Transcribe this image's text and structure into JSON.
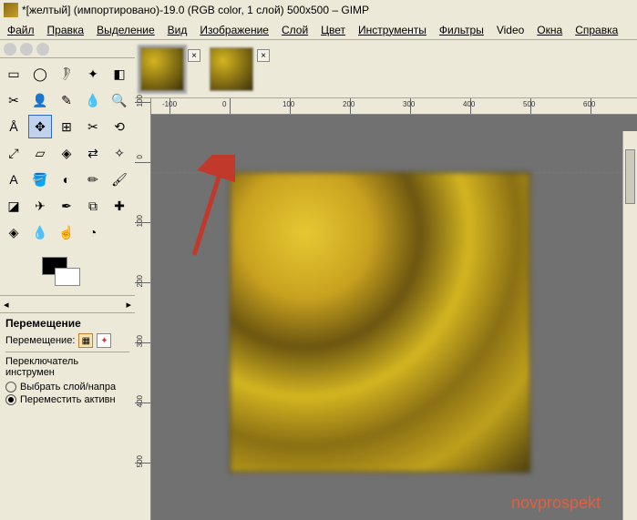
{
  "titlebar": {
    "text": "*[желтый] (импортировано)-19.0 (RGB color, 1 слой) 500x500 – GIMP"
  },
  "menu": {
    "file": "Файл",
    "edit": "Правка",
    "select": "Выделение",
    "view": "Вид",
    "image": "Изображение",
    "layer": "Слой",
    "color": "Цвет",
    "tools": "Инструменты",
    "filters": "Фильтры",
    "video": "Video",
    "windows": "Окна",
    "help": "Справка"
  },
  "hruler_ticks": [
    "-100",
    "0",
    "100",
    "200",
    "300",
    "400",
    "500",
    "600"
  ],
  "vruler_ticks": [
    "100",
    "0",
    "100",
    "200",
    "300",
    "400",
    "500"
  ],
  "move_options": {
    "title": "Перемещение",
    "label_move": "Перемещение:",
    "label_switch": "Переключатель инструмен",
    "radio_pick": "Выбрать слой/напра",
    "radio_move": "Переместить активн"
  },
  "watermark": "novprospekt",
  "tools": [
    {
      "name": "rect-select-icon",
      "glyph": "▭"
    },
    {
      "name": "ellipse-select-icon",
      "glyph": "◯"
    },
    {
      "name": "free-select-icon",
      "glyph": "𓏢"
    },
    {
      "name": "fuzzy-select-icon",
      "glyph": "✦"
    },
    {
      "name": "by-color-select-icon",
      "glyph": "◧"
    },
    {
      "name": "scissors-icon",
      "glyph": "✂"
    },
    {
      "name": "foreground-select-icon",
      "glyph": "👤"
    },
    {
      "name": "paths-icon",
      "glyph": "✎"
    },
    {
      "name": "color-picker-icon",
      "glyph": "💧"
    },
    {
      "name": "zoom-icon",
      "glyph": "🔍"
    },
    {
      "name": "measure-icon",
      "glyph": "Å"
    },
    {
      "name": "move-icon",
      "glyph": "✥",
      "active": true
    },
    {
      "name": "align-icon",
      "glyph": "⊞"
    },
    {
      "name": "crop-icon",
      "glyph": "✂"
    },
    {
      "name": "rotate-icon",
      "glyph": "⟲"
    },
    {
      "name": "scale-icon",
      "glyph": "⤢"
    },
    {
      "name": "shear-icon",
      "glyph": "▱"
    },
    {
      "name": "perspective-icon",
      "glyph": "◈"
    },
    {
      "name": "flip-icon",
      "glyph": "⇄"
    },
    {
      "name": "cage-icon",
      "glyph": "✧"
    },
    {
      "name": "text-icon",
      "glyph": "A"
    },
    {
      "name": "bucket-fill-icon",
      "glyph": "🪣"
    },
    {
      "name": "blend-icon",
      "glyph": "◐"
    },
    {
      "name": "pencil-icon",
      "glyph": "✏"
    },
    {
      "name": "paintbrush-icon",
      "glyph": "🖌"
    },
    {
      "name": "eraser-icon",
      "glyph": "◪"
    },
    {
      "name": "airbrush-icon",
      "glyph": "✈"
    },
    {
      "name": "ink-icon",
      "glyph": "✒"
    },
    {
      "name": "clone-icon",
      "glyph": "⧉"
    },
    {
      "name": "heal-icon",
      "glyph": "✚"
    },
    {
      "name": "perspective-clone-icon",
      "glyph": "◈"
    },
    {
      "name": "blur-icon",
      "glyph": "💧"
    },
    {
      "name": "smudge-icon",
      "glyph": "☝"
    },
    {
      "name": "dodge-burn-icon",
      "glyph": "◔"
    }
  ]
}
